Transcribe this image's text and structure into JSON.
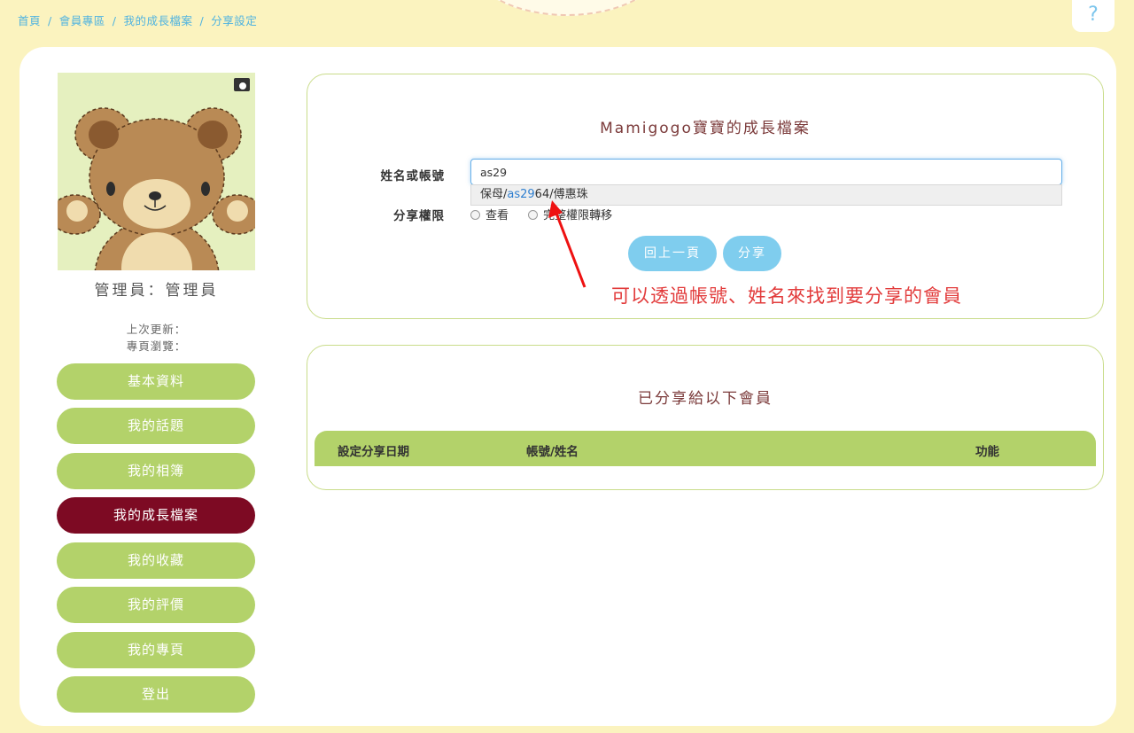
{
  "breadcrumb": [
    "首頁",
    "會員專區",
    "我的成長檔案",
    "分享設定"
  ],
  "help_label": "?",
  "profile": {
    "role": "管理員：管理員",
    "last_update": "上次更新：",
    "page_views": "專頁瀏覽："
  },
  "menu": [
    {
      "label": "基本資料",
      "active": false
    },
    {
      "label": "我的話題",
      "active": false
    },
    {
      "label": "我的相簿",
      "active": false
    },
    {
      "label": "我的成長檔案",
      "active": true
    },
    {
      "label": "我的收藏",
      "active": false
    },
    {
      "label": "我的評價",
      "active": false
    },
    {
      "label": "我的專頁",
      "active": false
    },
    {
      "label": "登出",
      "active": false
    }
  ],
  "share_form": {
    "title": "Mamigogo寶寶的成長檔案",
    "name_label": "姓名或帳號",
    "name_value": "as29",
    "suggestion_prefix": "保母/",
    "suggestion_highlight": "as29",
    "suggestion_suffix": "64/傅惠珠",
    "permission_label": "分享權限",
    "permission_options": [
      "查看",
      "完整權限轉移"
    ],
    "back_button": "回上一頁",
    "share_button": "分享"
  },
  "annotation": "可以透過帳號、姓名來找到要分享的會員",
  "shared_list": {
    "title": "已分享給以下會員",
    "columns": [
      "設定分享日期",
      "帳號/姓名",
      "功能"
    ]
  },
  "colors": {
    "menu_green": "#b3d26a",
    "menu_active": "#7d0a23",
    "button_blue": "#7fcdee",
    "annotation_red": "#e23b3b"
  }
}
